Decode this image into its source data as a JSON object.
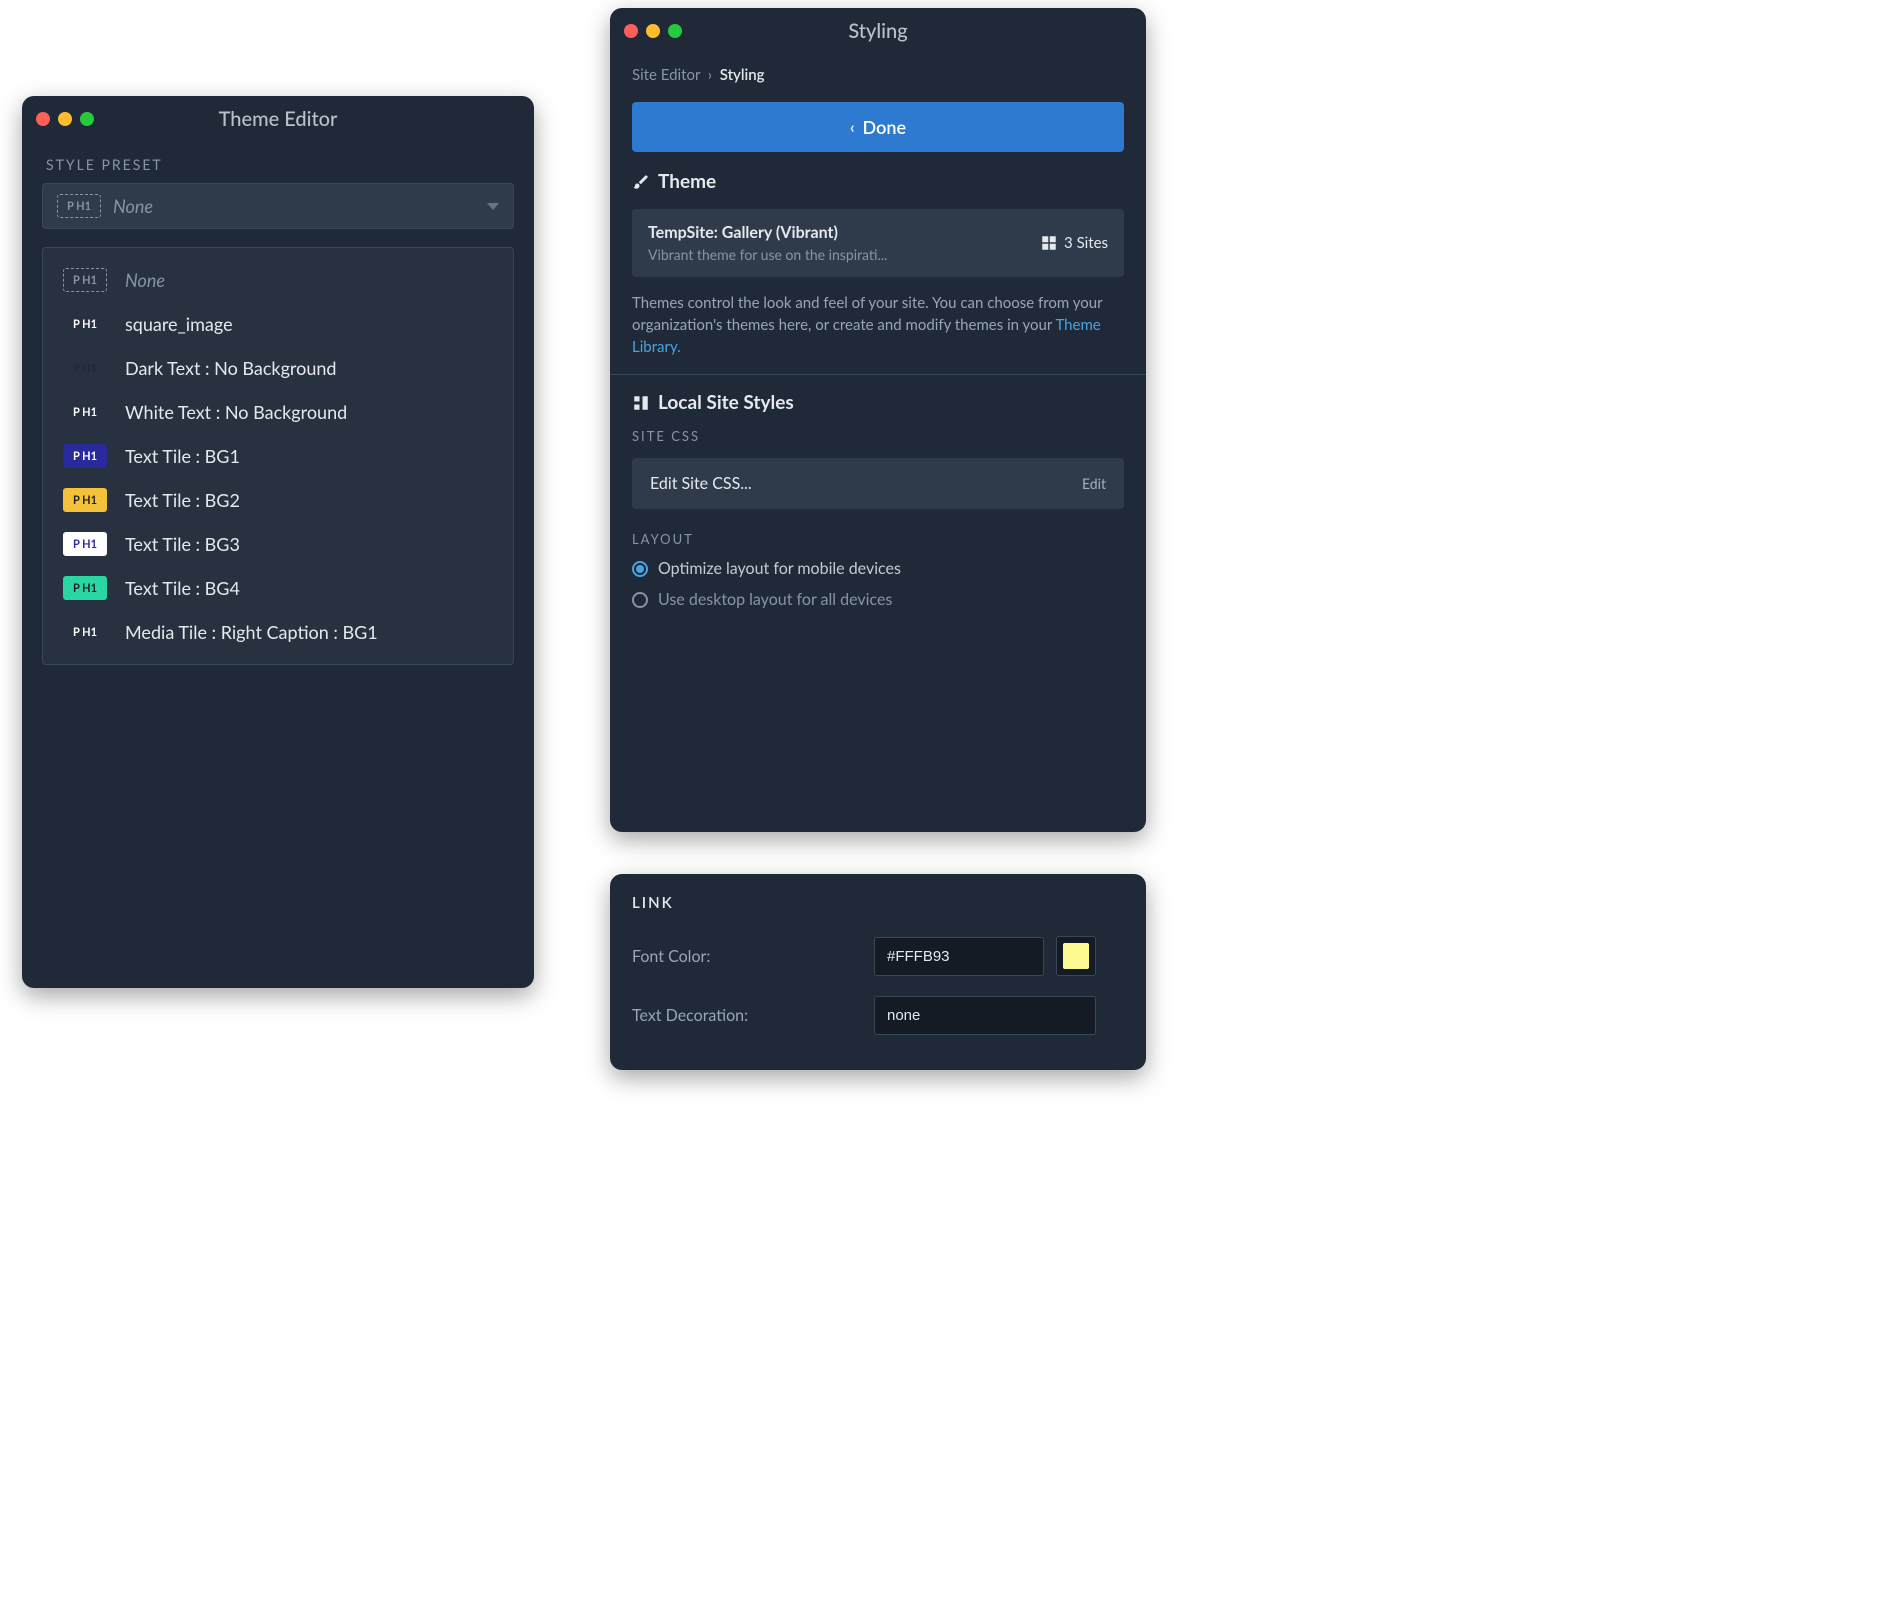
{
  "theme_editor": {
    "window_title": "Theme Editor",
    "preset_label": "STYLE PRESET",
    "selected": {
      "badge": "P H1",
      "label": "None"
    },
    "options": [
      {
        "badge": "P H1",
        "badge_style": "dashed",
        "label": "None",
        "italic": true
      },
      {
        "badge": "P H1",
        "badge_style": "plain",
        "label": "square_image"
      },
      {
        "badge": "P H1",
        "badge_style": "dark",
        "label": "Dark Text : No Background"
      },
      {
        "badge": "P H1",
        "badge_style": "plain",
        "label": "White Text : No Background"
      },
      {
        "badge": "P H1",
        "badge_style": "bg1",
        "label": "Text Tile : BG1"
      },
      {
        "badge": "P H1",
        "badge_style": "bg2",
        "label": "Text Tile : BG2"
      },
      {
        "badge": "P H1",
        "badge_style": "bg3",
        "label": "Text Tile : BG3"
      },
      {
        "badge": "P H1",
        "badge_style": "bg4",
        "label": "Text Tile : BG4"
      },
      {
        "badge": "P H1",
        "badge_style": "plain",
        "label": "Media Tile : Right Caption : BG1"
      }
    ]
  },
  "styling": {
    "window_title": "Styling",
    "breadcrumb_root": "Site Editor",
    "breadcrumb_sep": "›",
    "breadcrumb_current": "Styling",
    "done_label": "Done",
    "theme_heading": "Theme",
    "theme_name": "TempSite: Gallery (Vibrant)",
    "theme_desc": "Vibrant theme for use on the inspirati...",
    "sites_count": "3 Sites",
    "theme_help_1": "Themes control the look and feel of your site. You can choose from your organization's themes here, or create and modify themes in your ",
    "theme_help_link": "Theme Library.",
    "local_heading": "Local Site Styles",
    "site_css_label": "SITE CSS",
    "edit_css_text": "Edit Site CSS...",
    "edit_action": "Edit",
    "layout_label": "LAYOUT",
    "layout_opt1": "Optimize layout for mobile devices",
    "layout_opt2": "Use desktop layout for all devices"
  },
  "link_panel": {
    "heading": "LINK",
    "font_color_label": "Font Color:",
    "font_color_value": "#FFFB93",
    "swatch_color": "#FFFB93",
    "text_dec_label": "Text Decoration:",
    "text_dec_value": "none"
  }
}
